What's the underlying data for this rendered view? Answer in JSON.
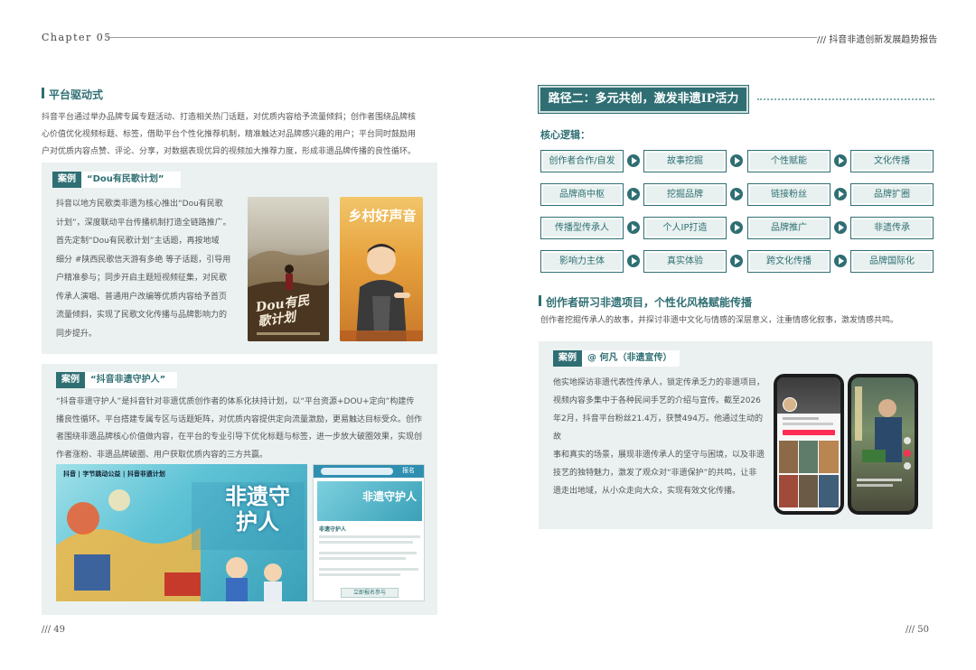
{
  "header": {
    "chapter": "Chapter 05",
    "report_title": "/// 抖音非遗创新发展趋势报告"
  },
  "left": {
    "section_title": "平台驱动式",
    "intro_lines": [
      "抖音平台通过举办品牌专属专题活动、打造相关热门话题，对优质内容给予流量倾斜；创作者围绕品牌核",
      "心价值优化视频标题、标签，借助平台个性化推荐机制，精准触达对品牌感兴趣的用户；平台同时鼓励用",
      "户对优质内容点赞、评论、分享，对数据表现优异的视频加大推荐力度，形成非遗品牌传播的良性循环。"
    ],
    "case1": {
      "badge": "案例",
      "name": "“Dou有民歌计划”",
      "lines": [
        "抖音以地方民歌类非遗为核心推出“Dou有民歌",
        "计划”，深度联动平台传播机制打造全链路推广。",
        "首先定制“Dou有民歌计划”主话题，再按地域",
        "细分 #陕西民歌信天游有多绝 等子话题，引导用",
        "户精准参与；同步开启主题短视频征集，对民歌",
        "传承人演唱、普通用户改编等优质内容给予首页",
        "流量倾斜，实现了民歌文化传播与品牌影响力的",
        "同步提升。"
      ],
      "poster1_text": "Dou有民歌计划",
      "poster2_text": "乡村好声音"
    },
    "case2": {
      "badge": "案例",
      "name": "“抖音非遗守护人”",
      "lines": [
        "“抖音非遗守护人”是抖音针对非遗优质创作者的体系化扶持计划，以“平台资源+DOU+定向”构建传",
        "播良性循环。平台搭建专属专区与话题矩阵，对优质内容提供定向流量激励，更易触达目标受众。创作",
        "者围绕非遗品牌核心价值做内容，在平台的专业引导下优化标题与标签，进一步放大破圈效果，实现创",
        "作者涨粉、非遗品牌破圈、用户获取优质内容的三方共赢。"
      ],
      "banner_logos": "抖音 | 字节跳动公益 | 抖音非遗计划",
      "banner_text": "非遗守护人",
      "app_title": "非遗守护人",
      "app_btn": "报名",
      "app_text": "非遗守护人",
      "app_btn_bottom": "立即报名参与"
    },
    "page_number": "/// 49"
  },
  "right": {
    "path_title": "路径二：多元共创，激发非遗IP活力",
    "logic_title": "核心逻辑：",
    "grid": [
      [
        "创作者合作/自发",
        "故事挖掘",
        "个性赋能",
        "文化传播"
      ],
      [
        "品牌商中枢",
        "挖掘品牌",
        "链接粉丝",
        "品牌扩圈"
      ],
      [
        "传播型传承人",
        "个人IP打造",
        "品牌推广",
        "非遗传承"
      ],
      [
        "影响力主体",
        "真实体验",
        "跨文化传播",
        "品牌国际化"
      ]
    ],
    "section_title": "创作者研习非遗项目，个性化风格赋能传播",
    "section_desc": "创作者挖掘传承人的故事，并探讨非遗中文化与情感的深层意义，注重情感化叙事，激发情感共鸣。",
    "case": {
      "badge": "案例",
      "name": "@ 何凡（非遗宣传）",
      "lines": [
        "他实地探访非遗代表性传承人，锁定传承乏力的非遗项目，",
        "视频内容多集中于各种民间手艺的介绍与宣传。截至2026",
        "年2月，抖音平台粉丝21.4万，获赞494万。他通过生动的故",
        "事和真实的场景，展现非遗传承人的坚守与困境，以及非遗",
        "技艺的独特魅力，激发了观众对“非遗保护”的共鸣，让非",
        "遗走出地域，从小众走向大众，实现有效文化传播。"
      ]
    },
    "page_number": "/// 50"
  },
  "colors": {
    "accent": "#2f6f73",
    "panel": "#eaf1f0",
    "box_fill": "#e8f1ef"
  }
}
